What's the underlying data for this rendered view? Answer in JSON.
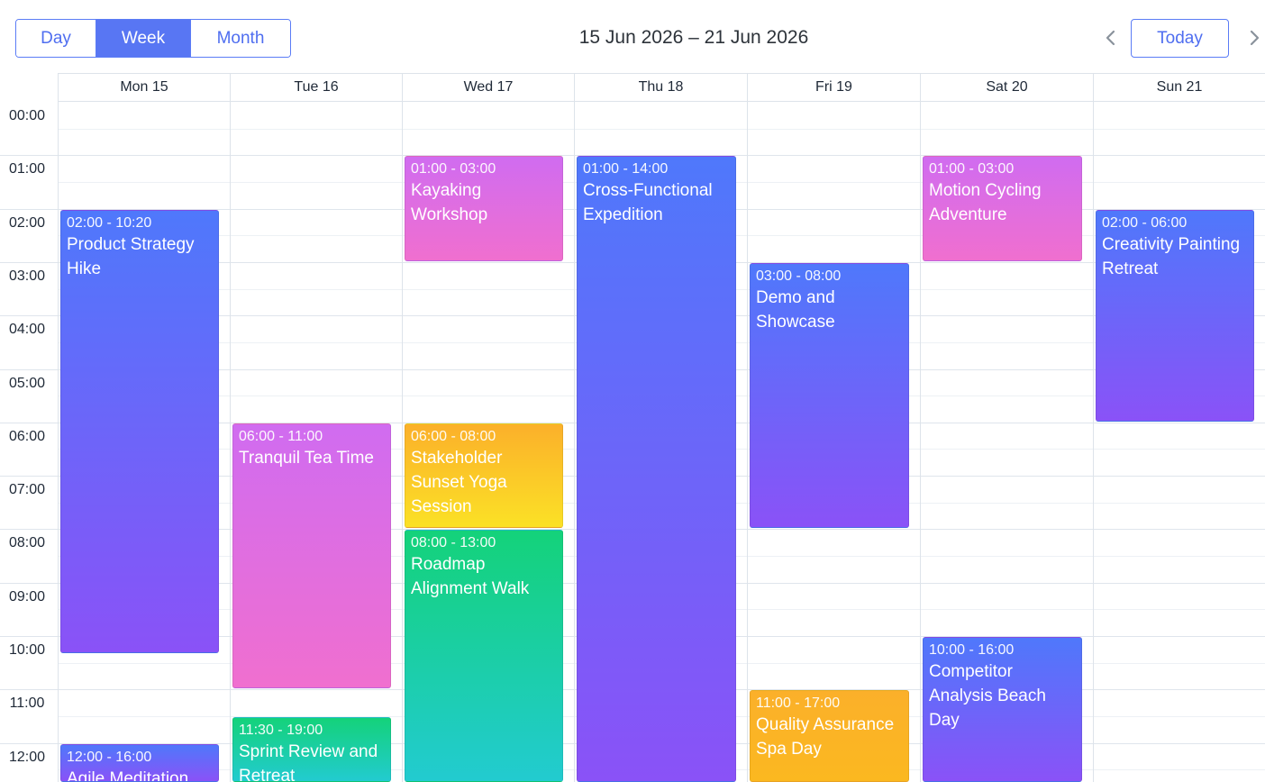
{
  "header": {
    "views": [
      {
        "label": "Day",
        "active": false
      },
      {
        "label": "Week",
        "active": true
      },
      {
        "label": "Month",
        "active": false
      }
    ],
    "title": "15 Jun 2026 – 21 Jun 2026",
    "today_label": "Today",
    "prev_icon": "chevron-left-icon",
    "next_icon": "chevron-right-icon"
  },
  "days": [
    "Mon 15",
    "Tue 16",
    "Wed 17",
    "Thu 18",
    "Fri 19",
    "Sat 20",
    "Sun 21"
  ],
  "hours": [
    "00:00",
    "01:00",
    "02:00",
    "03:00",
    "04:00",
    "05:00",
    "06:00",
    "07:00",
    "08:00",
    "09:00",
    "10:00",
    "11:00",
    "12:00"
  ],
  "events": [
    {
      "day": 0,
      "start": 2,
      "end": 10.333,
      "time": "02:00 - 10:20",
      "title": "Product Strategy Hike",
      "style": "g-blue"
    },
    {
      "day": 0,
      "start": 12,
      "end": 16,
      "time": "12:00 - 16:00",
      "title": "Agile Meditation",
      "style": "g-blue"
    },
    {
      "day": 1,
      "start": 6,
      "end": 11,
      "time": "06:00 - 11:00",
      "title": "Tranquil Tea Time",
      "style": "g-pink"
    },
    {
      "day": 1,
      "start": 11.5,
      "end": 19,
      "time": "11:30 - 19:00",
      "title": "Sprint Review and Retreat",
      "style": "g-green"
    },
    {
      "day": 2,
      "start": 1,
      "end": 3,
      "time": "01:00 - 03:00",
      "title": "Kayaking Workshop",
      "style": "g-pink"
    },
    {
      "day": 2,
      "start": 6,
      "end": 8,
      "time": "06:00 - 08:00",
      "title": "Stakeholder Sunset Yoga Session",
      "style": "g-amber"
    },
    {
      "day": 2,
      "start": 8,
      "end": 13,
      "time": "08:00 - 13:00",
      "title": "Roadmap Alignment Walk",
      "style": "g-green"
    },
    {
      "day": 3,
      "start": 1,
      "end": 14,
      "time": "01:00 - 14:00",
      "title": "Cross-Functional Expedition",
      "style": "g-blue"
    },
    {
      "day": 4,
      "start": 3,
      "end": 8,
      "time": "03:00 - 08:00",
      "title": "Demo and Showcase",
      "style": "g-blue"
    },
    {
      "day": 4,
      "start": 11,
      "end": 17,
      "time": "11:00 - 17:00",
      "title": "Quality Assurance Spa Day",
      "style": "g-orange"
    },
    {
      "day": 5,
      "start": 1,
      "end": 3,
      "time": "01:00 - 03:00",
      "title": "Motion Cycling Adventure",
      "style": "g-pink"
    },
    {
      "day": 5,
      "start": 10,
      "end": 16,
      "time": "10:00 - 16:00",
      "title": "Competitor Analysis Beach Day",
      "style": "g-blue"
    },
    {
      "day": 6,
      "start": 2,
      "end": 6,
      "time": "02:00 - 06:00",
      "title": "Creativity Painting Retreat",
      "style": "g-blue"
    }
  ]
}
